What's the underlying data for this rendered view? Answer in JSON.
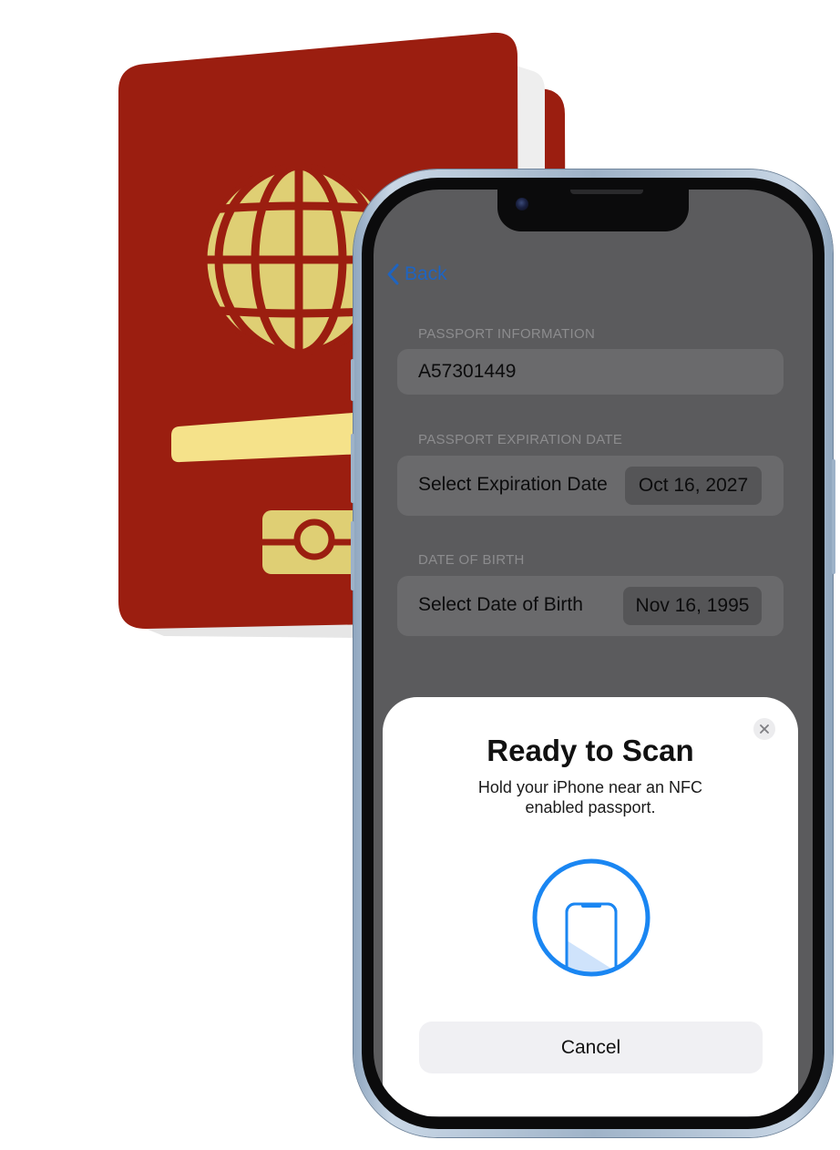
{
  "nav": {
    "back_label": "Back"
  },
  "passport_number": {
    "section_title": "PASSPORT INFORMATION",
    "value": "A57301449"
  },
  "expiration": {
    "section_title": "PASSPORT EXPIRATION DATE",
    "label": "Select Expiration Date",
    "date": "Oct 16, 2027"
  },
  "birth": {
    "section_title": "DATE OF BIRTH",
    "label": "Select Date of Birth",
    "date": "Nov 16, 1995"
  },
  "scan_sheet": {
    "title": "Ready to Scan",
    "message": "Hold your iPhone near an NFC enabled passport.",
    "cancel_label": "Cancel",
    "close_icon": "close-icon",
    "scan_icon": "phone-scan-icon"
  },
  "colors": {
    "passport_cover": "#9b1e10",
    "passport_emblem": "#dfcf74",
    "accent_blue": "#1a86f2",
    "dimmed_background": "#5b5b5d"
  }
}
